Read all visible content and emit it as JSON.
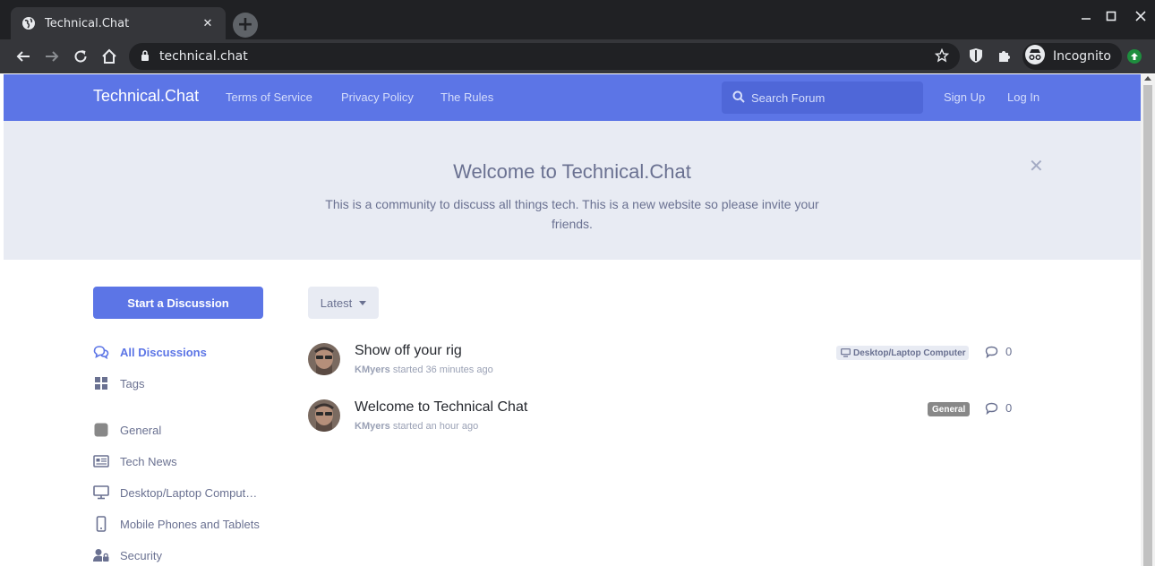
{
  "browser": {
    "tab_title": "Technical.Chat",
    "url": "technical.chat",
    "profile_label": "Incognito"
  },
  "header": {
    "brand": "Technical.Chat",
    "nav": [
      "Terms of Service",
      "Privacy Policy",
      "The Rules"
    ],
    "search_placeholder": "Search Forum",
    "sign_up": "Sign Up",
    "log_in": "Log In"
  },
  "hero": {
    "title": "Welcome to Technical.Chat",
    "description": "This is a community to discuss all things tech. This is a new website so please invite your friends."
  },
  "sidebar": {
    "start_button": "Start a Discussion",
    "items": [
      {
        "label": "All Discussions",
        "icon": "comments-icon",
        "active": true
      },
      {
        "label": "Tags",
        "icon": "grid-icon",
        "active": false
      },
      {
        "label": "General",
        "icon": "square-tag-icon",
        "active": false
      },
      {
        "label": "Tech News",
        "icon": "newspaper-icon",
        "active": false
      },
      {
        "label": "Desktop/Laptop Comput…",
        "icon": "desktop-icon",
        "active": false
      },
      {
        "label": "Mobile Phones and Tablets",
        "icon": "mobile-icon",
        "active": false
      },
      {
        "label": "Security",
        "icon": "user-lock-icon",
        "active": false
      }
    ]
  },
  "toolbar": {
    "sort_label": "Latest"
  },
  "discussions": [
    {
      "title": "Show off your rig",
      "user": "KMyers",
      "started": "started 36 minutes ago",
      "tag": "Desktop/Laptop Computer",
      "replies": "0"
    },
    {
      "title": "Welcome to Technical Chat",
      "user": "KMyers",
      "started": "started an hour ago",
      "tag": "General",
      "replies": "0"
    }
  ],
  "colors": {
    "primary": "#5c75e6",
    "hero_bg": "#e8ebf3",
    "muted_text": "#6a7191",
    "general_tag": "#888888"
  }
}
